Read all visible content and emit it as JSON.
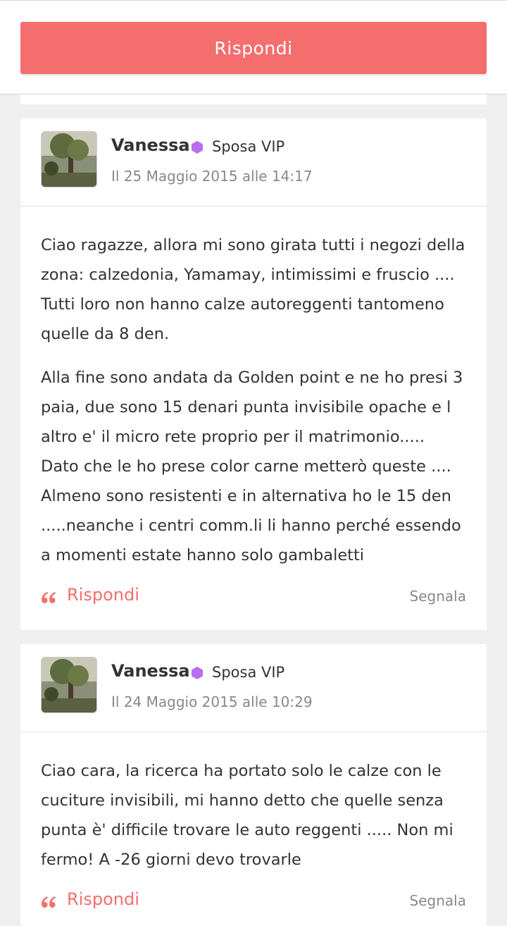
{
  "top": {
    "reply_label": "Rispondi"
  },
  "posts": [
    {
      "author": "Vanessa",
      "badge": "Sposa VIP",
      "date": "Il 25 Maggio 2015 alle 14:17",
      "paragraphs": [
        "Ciao ragazze, allora mi sono girata tutti i negozi della zona: calzedonia, Yamamay, intimissimi e fruscio .... Tutti loro non hanno calze autoreggenti tantomeno quelle da 8 den.",
        "Alla fine sono andata da Golden point e ne ho presi 3 paia, due sono 15 denari punta invisibile opache e l altro e' il micro rete proprio per il matrimonio..... Dato che le ho prese color carne metterò queste .... Almeno sono resistenti e in alternativa ho le 15 den .....neanche i centri comm.li li hanno perché essendo a momenti estate hanno solo gambaletti"
      ],
      "reply_label": "Rispondi",
      "report_label": "Segnala"
    },
    {
      "author": "Vanessa",
      "badge": "Sposa VIP",
      "date": "Il 24 Maggio 2015 alle 10:29",
      "paragraphs": [
        "Ciao cara, la ricerca ha portato solo le calze con le cuciture invisibili, mi hanno detto che quelle senza punta è' difficile trovare le auto reggenti ..... Non mi fermo! A -26 giorni devo trovarle"
      ],
      "reply_label": "Rispondi",
      "report_label": "Segnala"
    }
  ],
  "colors": {
    "accent": "#f46e6e",
    "vip": "#b86ef0",
    "muted": "#888888"
  }
}
